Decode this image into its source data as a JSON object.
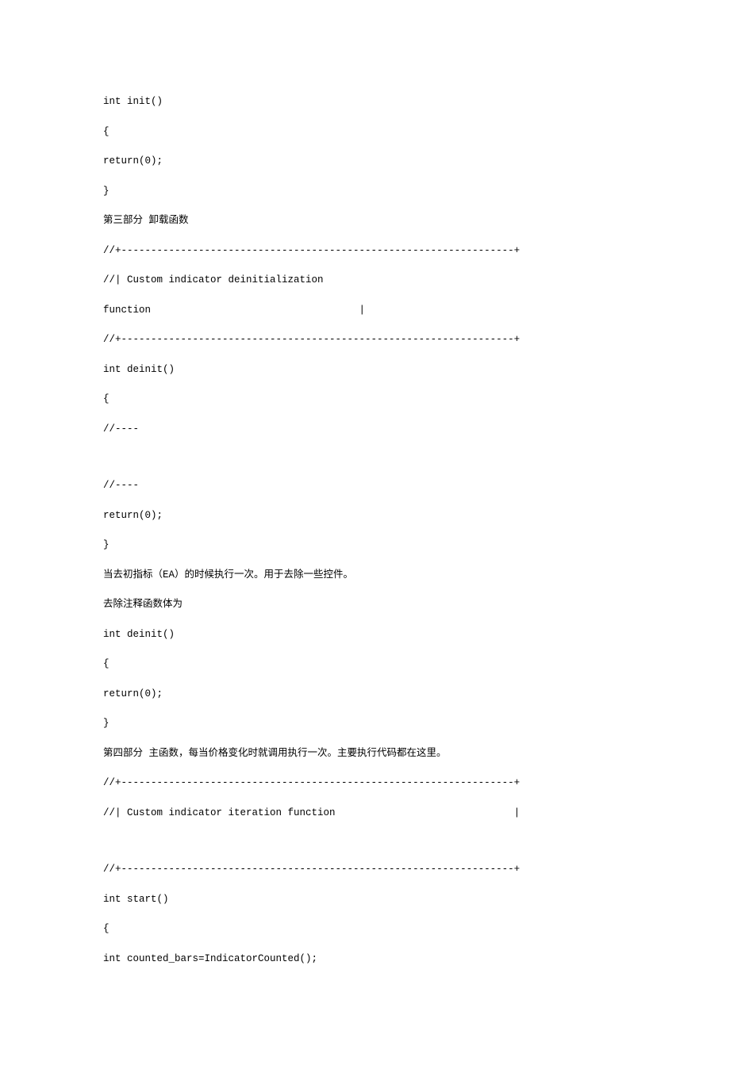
{
  "lines": {
    "l1": "int init()",
    "l2": "{",
    "l3": "return(0);",
    "l4": "}",
    "l5": "第三部分 卸载函数",
    "l6": "//+------------------------------------------------------------------+",
    "l7": "//| Custom indicator deinitialization",
    "l8": "function                                   |",
    "l9": "//+------------------------------------------------------------------+",
    "l10": "int deinit()",
    "l11": "{",
    "l12": "//----",
    "l13": "//----",
    "l14": "return(0);",
    "l15": "}",
    "l16": "当去初指标（EA）的时候执行一次。用于去除一些控件。",
    "l17": "去除注释函数体为",
    "l18": "int deinit()",
    "l19": "{",
    "l20": "return(0);",
    "l21": "}",
    "l22": "第四部分 主函数，每当价格变化时就调用执行一次。主要执行代码都在这里。",
    "l23": "//+------------------------------------------------------------------+",
    "l24": "//| Custom indicator iteration function                              |",
    "l25": "//+------------------------------------------------------------------+",
    "l26": "int start()",
    "l27": "{",
    "l28": "int counted_bars=IndicatorCounted();"
  }
}
